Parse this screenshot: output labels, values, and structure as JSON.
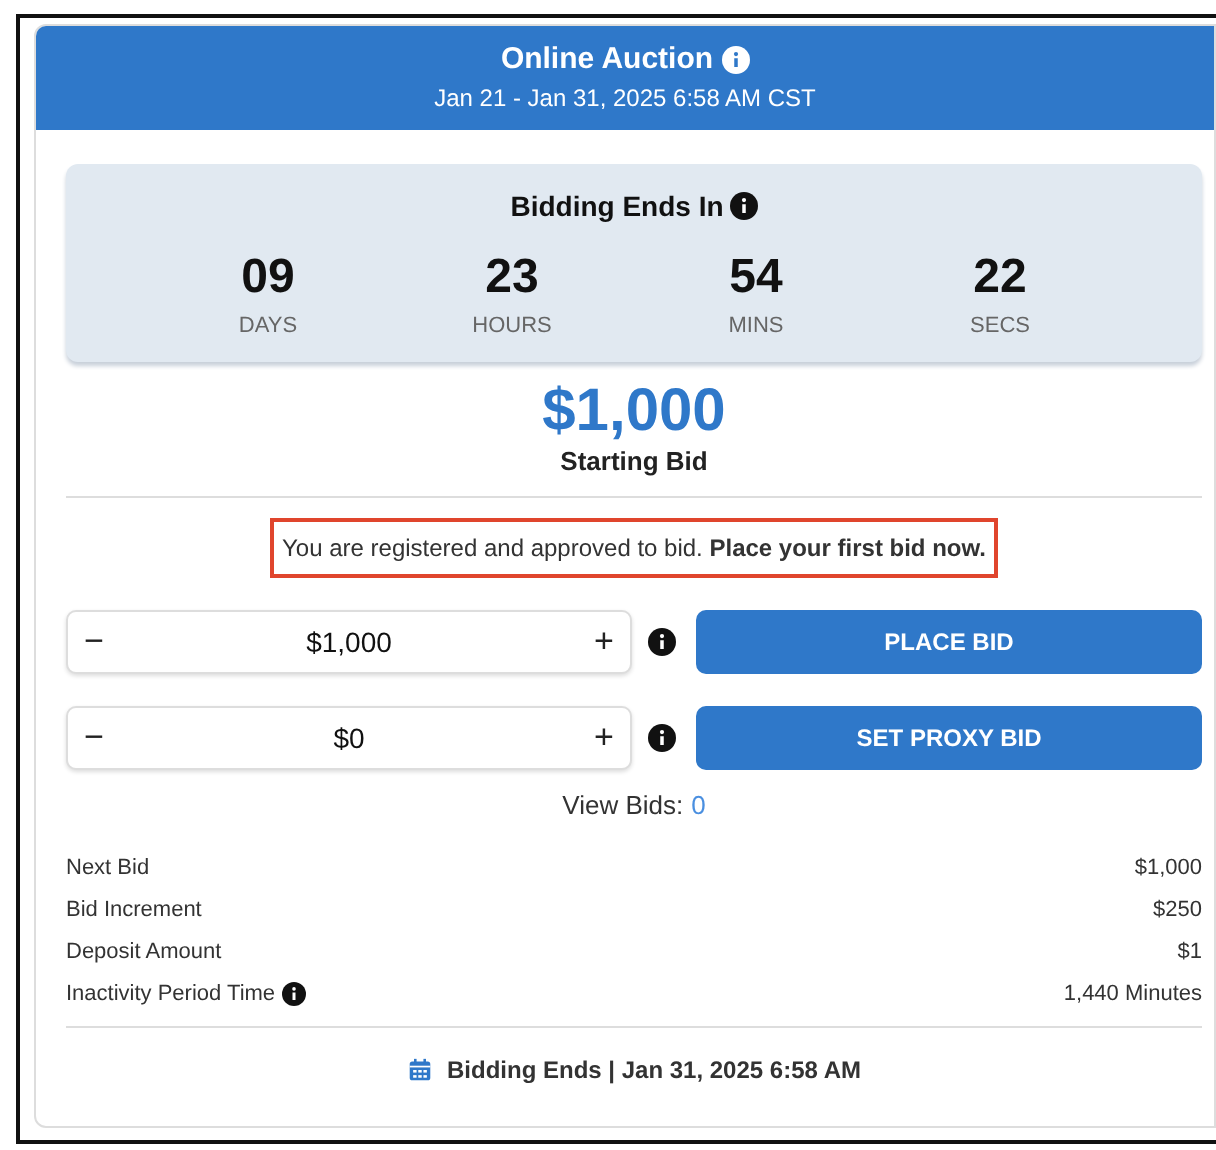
{
  "header": {
    "title": "Online Auction",
    "subtitle": "Jan 21 - Jan 31, 2025 6:58 AM CST"
  },
  "countdown": {
    "title": "Bidding Ends In",
    "units": [
      {
        "value": "09",
        "label": "DAYS"
      },
      {
        "value": "23",
        "label": "HOURS"
      },
      {
        "value": "54",
        "label": "MINS"
      },
      {
        "value": "22",
        "label": "SECS"
      }
    ]
  },
  "starting_bid": {
    "amount": "$1,000",
    "label": "Starting Bid"
  },
  "message": {
    "text": "You are registered and approved to bid. **Place your first bid now.**",
    "highlighted": true
  },
  "bid_controls": [
    {
      "minus": "−",
      "value": "$1,000",
      "plus": "+",
      "button": "PLACE BID"
    },
    {
      "minus": "−",
      "value": "$0",
      "plus": "+",
      "button": "SET PROXY BID"
    }
  ],
  "view_bids": {
    "label": "View Bids:",
    "count": "0"
  },
  "details": [
    {
      "label": "Next Bid",
      "value": "$1,000",
      "info": false
    },
    {
      "label": "Bid Increment",
      "value": "$250",
      "info": false
    },
    {
      "label": "Deposit Amount",
      "value": "$1",
      "info": false
    },
    {
      "label": "Inactivity Period Time",
      "value": "1,440 Minutes",
      "info": true
    }
  ],
  "footer": {
    "text": "Bidding Ends | Jan 31, 2025 6:58 AM"
  }
}
